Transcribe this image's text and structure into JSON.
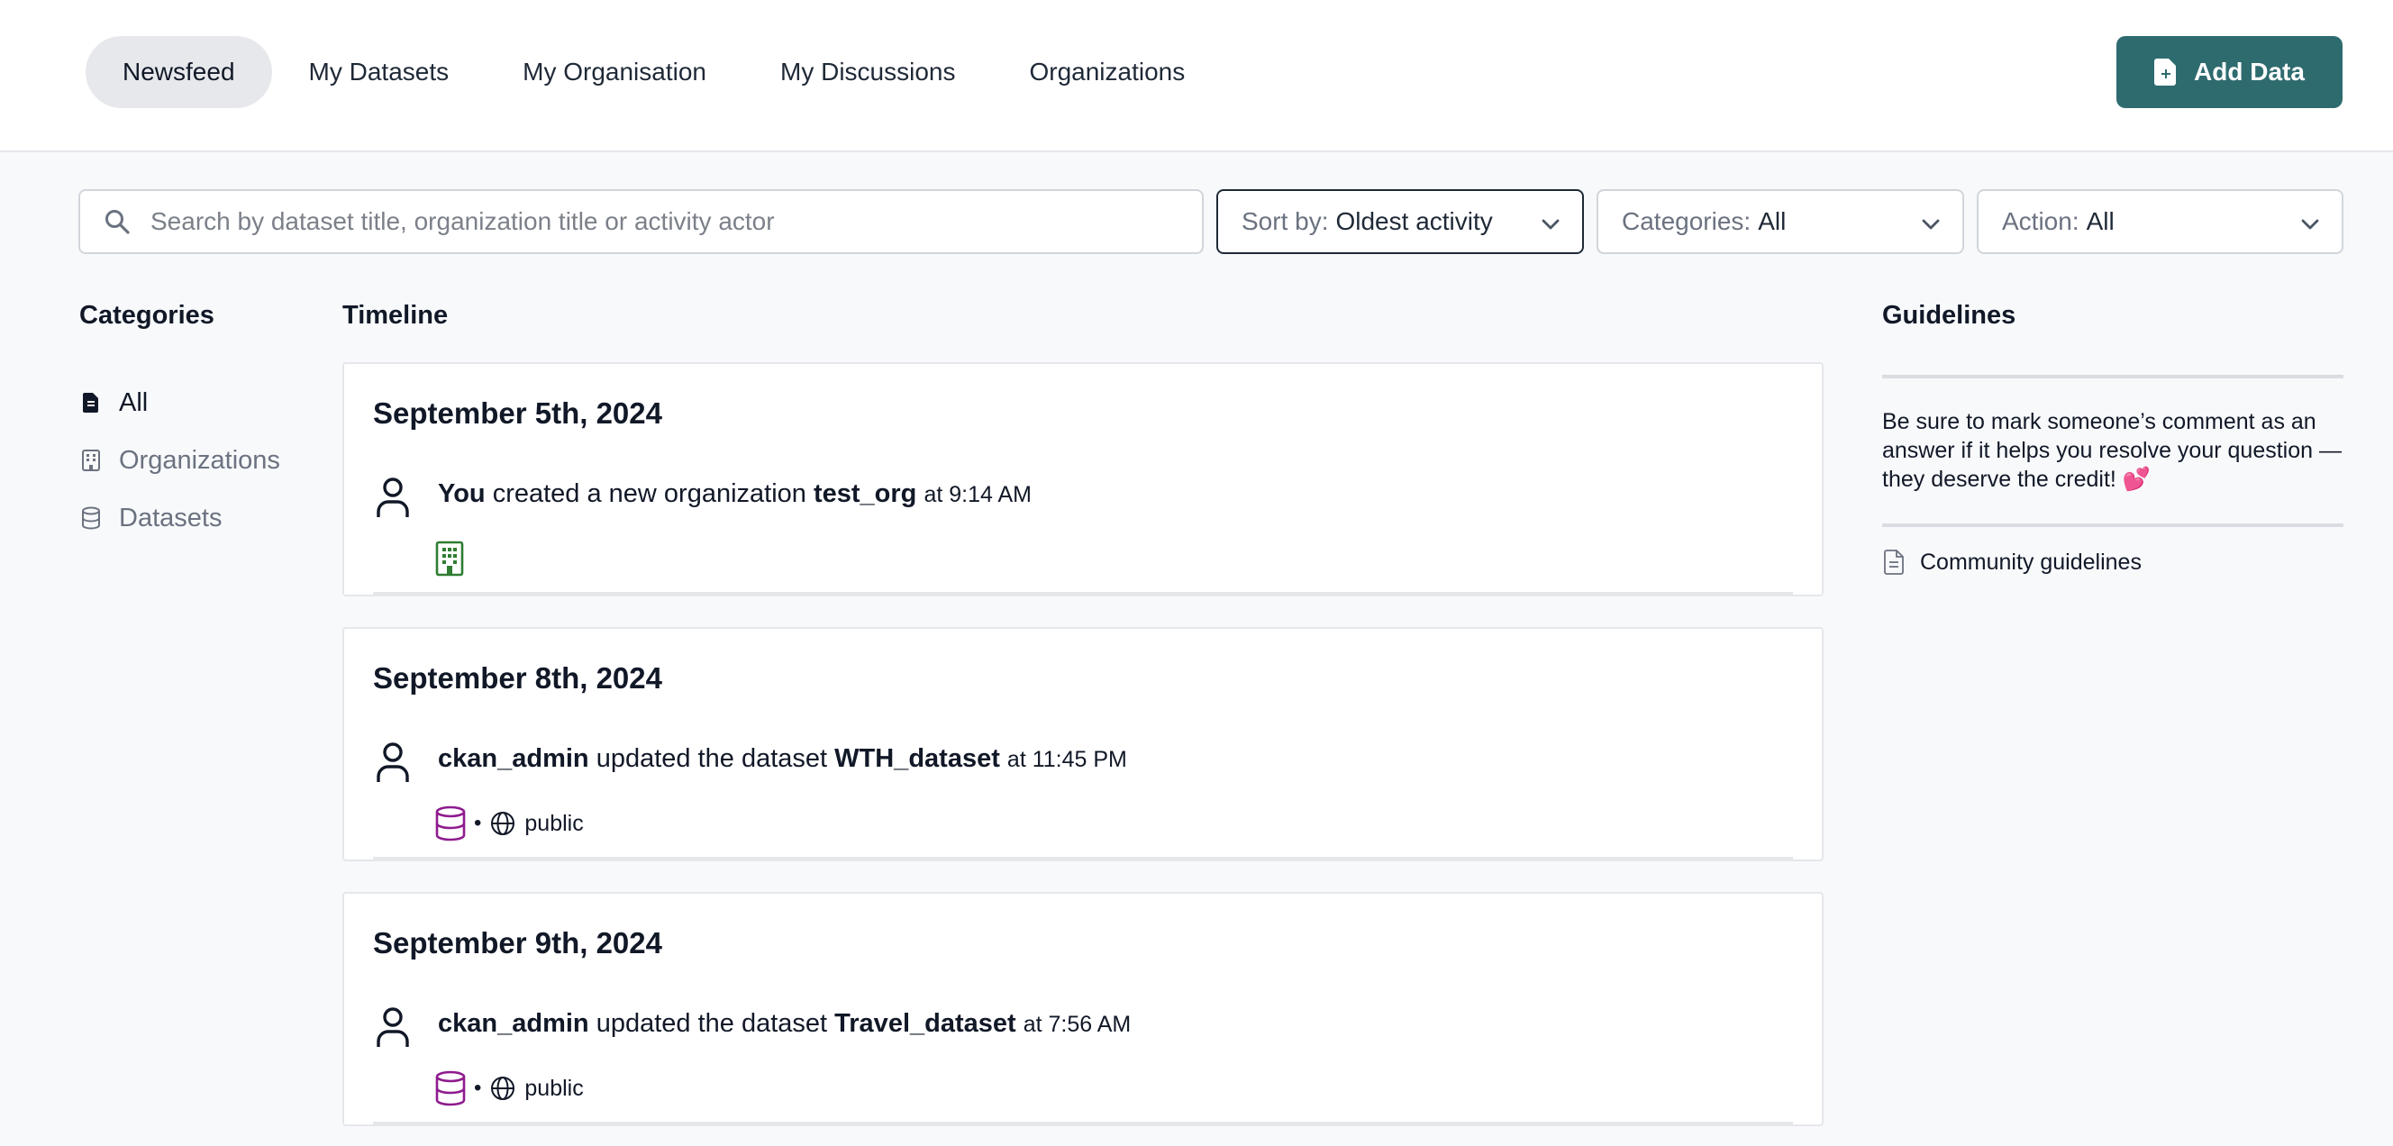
{
  "nav": {
    "items": [
      {
        "label": "Newsfeed",
        "active": true
      },
      {
        "label": "My Datasets",
        "active": false
      },
      {
        "label": "My Organisation",
        "active": false
      },
      {
        "label": "My Discussions",
        "active": false
      },
      {
        "label": "Organizations",
        "active": false
      }
    ],
    "add_button": "Add Data"
  },
  "filters": {
    "search_placeholder": "Search by dataset title, organization title or activity actor",
    "sort": {
      "key": "Sort by:",
      "value": "Oldest activity"
    },
    "categories": {
      "key": "Categories:",
      "value": "All"
    },
    "action": {
      "key": "Action:",
      "value": "All"
    }
  },
  "sidebar": {
    "title": "Categories",
    "items": [
      {
        "label": "All",
        "icon": "file-icon",
        "active": true
      },
      {
        "label": "Organizations",
        "icon": "building-icon",
        "active": false
      },
      {
        "label": "Datasets",
        "icon": "database-icon",
        "active": false
      }
    ]
  },
  "timeline": {
    "title": "Timeline",
    "entries": [
      {
        "date": "September 5th, 2024",
        "actor": "You",
        "verb": "created a new organization",
        "object": "test_org",
        "time": "at 9:14 AM",
        "kind_icon": "organization-icon",
        "visibility": ""
      },
      {
        "date": "September 8th, 2024",
        "actor": "ckan_admin",
        "verb": "updated the dataset",
        "object": "WTH_dataset",
        "time": "at 11:45 PM",
        "kind_icon": "dataset-icon",
        "bullet": "•",
        "visibility": "public"
      },
      {
        "date": "September 9th, 2024",
        "actor": "ckan_admin",
        "verb": "updated the dataset",
        "object": "Travel_dataset",
        "time": "at 7:56 AM",
        "kind_icon": "dataset-icon",
        "bullet": "•",
        "visibility": "public"
      }
    ]
  },
  "guidelines": {
    "title": "Guidelines",
    "text": "Be sure to mark someone’s comment as an answer if it helps you resolve your question — they deserve the credit! 💕",
    "link": "Community guidelines"
  },
  "colors": {
    "accent": "#2e6b6f",
    "organization_icon": "#2e7d32",
    "dataset_icon": "#8e1b8e"
  }
}
